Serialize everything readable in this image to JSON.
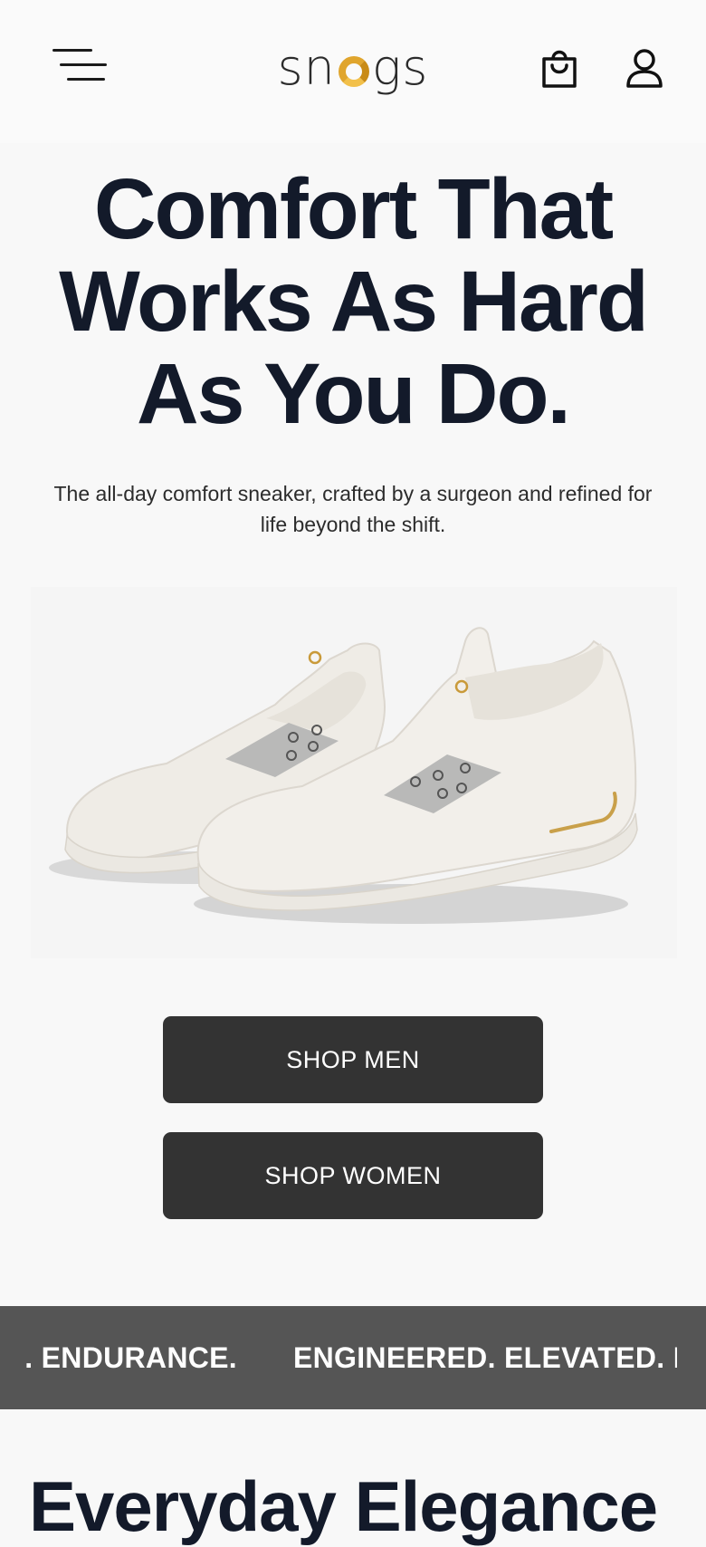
{
  "header": {
    "menu_icon": "hamburger-menu-icon",
    "logo_text_start": "sn",
    "logo_text_end": "gs",
    "logo_alt": "snogs",
    "cart_icon": "shopping-bag-icon",
    "account_icon": "user-icon"
  },
  "hero": {
    "title_line1": "Comfort That",
    "title_line2": "Works As Hard",
    "title_line3": "As You Do.",
    "subtitle": "The all-day comfort sneaker, crafted by a surgeon and refined for life beyond the shift."
  },
  "buttons": {
    "shop_men": "SHOP MEN",
    "shop_women": "SHOP WOMEN"
  },
  "ticker": {
    "segment_a": ". ENDURANCE.",
    "segment_b": "ENGINEERED. ELEVATED. EI"
  },
  "section": {
    "title": "Everyday Elegance"
  },
  "colors": {
    "background": "#f8f8f8",
    "heading": "#131a2a",
    "button": "#333333",
    "ticker_bg": "#555555",
    "logo_accent": "#e0a52d"
  }
}
